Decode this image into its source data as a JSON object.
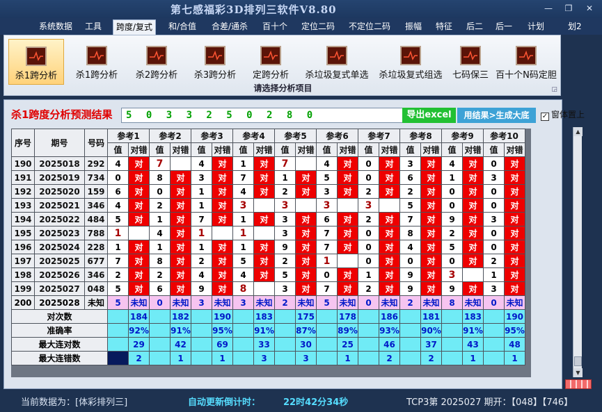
{
  "title": "第七感福彩3D排列三软件V8.80",
  "menu": [
    "系统数据",
    "工具",
    "跨度/复式",
    "和/合值",
    "合差/通杀",
    "百十个",
    "定位二码",
    "不定位二码",
    "振幅",
    "特征",
    "后二",
    "后一",
    "计划",
    "划2"
  ],
  "ribbon": {
    "buttons": [
      "杀1跨分析",
      "杀1跨分析",
      "杀2跨分析",
      "杀3跨分析",
      "定跨分析",
      "杀垃圾复式单选",
      "杀垃圾复式组选",
      "七码保三",
      "百十个N码定胆"
    ],
    "group_label": "请选择分析项目"
  },
  "panel": {
    "heading": "杀1跨度分析预测结果",
    "result_value": "5 0 3 3 2 5 0 2 8 0",
    "excel_label": "导出excel",
    "big_label": "用结果>生成大底",
    "topmost_label": "窗体置上",
    "topmost_check": "✓"
  },
  "table": {
    "headers": {
      "seq": "序号",
      "period": "期号",
      "code": "号码",
      "refs": [
        "参考1",
        "参考2",
        "参考3",
        "参考4",
        "参考5",
        "参考6",
        "参考7",
        "参考8",
        "参考9",
        "参考10"
      ],
      "val": "值",
      "judge": "对错"
    },
    "rows": [
      {
        "seq": "190",
        "period": "2025018",
        "code": "292",
        "cells": [
          [
            "4",
            "对"
          ],
          [
            "7",
            ""
          ],
          [
            "4",
            "对"
          ],
          [
            "1",
            "对"
          ],
          [
            "7",
            ""
          ],
          [
            "4",
            "对"
          ],
          [
            "0",
            "对"
          ],
          [
            "3",
            "对"
          ],
          [
            "4",
            "对"
          ],
          [
            "0",
            "对"
          ]
        ]
      },
      {
        "seq": "191",
        "period": "2025019",
        "code": "734",
        "cells": [
          [
            "0",
            "对"
          ],
          [
            "8",
            "对"
          ],
          [
            "3",
            "对"
          ],
          [
            "7",
            "对"
          ],
          [
            "1",
            "对"
          ],
          [
            "5",
            "对"
          ],
          [
            "0",
            "对"
          ],
          [
            "6",
            "对"
          ],
          [
            "1",
            "对"
          ],
          [
            "3",
            "对"
          ]
        ]
      },
      {
        "seq": "192",
        "period": "2025020",
        "code": "159",
        "cells": [
          [
            "6",
            "对"
          ],
          [
            "0",
            "对"
          ],
          [
            "1",
            "对"
          ],
          [
            "4",
            "对"
          ],
          [
            "2",
            "对"
          ],
          [
            "3",
            "对"
          ],
          [
            "2",
            "对"
          ],
          [
            "2",
            "对"
          ],
          [
            "0",
            "对"
          ],
          [
            "0",
            "对"
          ]
        ]
      },
      {
        "seq": "193",
        "period": "2025021",
        "code": "346",
        "cells": [
          [
            "4",
            "对"
          ],
          [
            "2",
            "对"
          ],
          [
            "1",
            "对"
          ],
          [
            "3",
            ""
          ],
          [
            "3",
            ""
          ],
          [
            "3",
            ""
          ],
          [
            "3",
            ""
          ],
          [
            "5",
            "对"
          ],
          [
            "0",
            "对"
          ],
          [
            "0",
            "对"
          ]
        ]
      },
      {
        "seq": "194",
        "period": "2025022",
        "code": "484",
        "cells": [
          [
            "5",
            "对"
          ],
          [
            "1",
            "对"
          ],
          [
            "7",
            "对"
          ],
          [
            "1",
            "对"
          ],
          [
            "3",
            "对"
          ],
          [
            "6",
            "对"
          ],
          [
            "2",
            "对"
          ],
          [
            "7",
            "对"
          ],
          [
            "9",
            "对"
          ],
          [
            "3",
            "对"
          ]
        ]
      },
      {
        "seq": "195",
        "period": "2025023",
        "code": "788",
        "cells": [
          [
            "1",
            ""
          ],
          [
            "4",
            "对"
          ],
          [
            "1",
            ""
          ],
          [
            "1",
            ""
          ],
          [
            "3",
            "对"
          ],
          [
            "7",
            "对"
          ],
          [
            "0",
            "对"
          ],
          [
            "8",
            "对"
          ],
          [
            "2",
            "对"
          ],
          [
            "0",
            "对"
          ]
        ]
      },
      {
        "seq": "196",
        "period": "2025024",
        "code": "228",
        "cells": [
          [
            "1",
            "对"
          ],
          [
            "1",
            "对"
          ],
          [
            "1",
            "对"
          ],
          [
            "1",
            "对"
          ],
          [
            "9",
            "对"
          ],
          [
            "7",
            "对"
          ],
          [
            "0",
            "对"
          ],
          [
            "4",
            "对"
          ],
          [
            "5",
            "对"
          ],
          [
            "0",
            "对"
          ]
        ]
      },
      {
        "seq": "197",
        "period": "2025025",
        "code": "677",
        "cells": [
          [
            "7",
            "对"
          ],
          [
            "8",
            "对"
          ],
          [
            "2",
            "对"
          ],
          [
            "5",
            "对"
          ],
          [
            "2",
            "对"
          ],
          [
            "1",
            ""
          ],
          [
            "0",
            "对"
          ],
          [
            "0",
            "对"
          ],
          [
            "0",
            "对"
          ],
          [
            "2",
            "对"
          ]
        ]
      },
      {
        "seq": "198",
        "period": "2025026",
        "code": "346",
        "cells": [
          [
            "2",
            "对"
          ],
          [
            "2",
            "对"
          ],
          [
            "4",
            "对"
          ],
          [
            "4",
            "对"
          ],
          [
            "5",
            "对"
          ],
          [
            "0",
            "对"
          ],
          [
            "1",
            "对"
          ],
          [
            "9",
            "对"
          ],
          [
            "3",
            ""
          ],
          [
            "1",
            "对"
          ]
        ]
      },
      {
        "seq": "199",
        "period": "2025027",
        "code": "048",
        "cells": [
          [
            "5",
            "对"
          ],
          [
            "6",
            "对"
          ],
          [
            "9",
            "对"
          ],
          [
            "8",
            ""
          ],
          [
            "3",
            "对"
          ],
          [
            "7",
            "对"
          ],
          [
            "2",
            "对"
          ],
          [
            "9",
            "对"
          ],
          [
            "9",
            "对"
          ],
          [
            "3",
            "对"
          ]
        ]
      }
    ],
    "highlight": [
      [
        false,
        true,
        false,
        false,
        true,
        false,
        false,
        false,
        false,
        false
      ],
      [
        false,
        false,
        false,
        false,
        false,
        false,
        false,
        false,
        false,
        false
      ],
      [
        false,
        false,
        false,
        false,
        false,
        false,
        false,
        false,
        false,
        false
      ],
      [
        false,
        false,
        false,
        true,
        true,
        true,
        true,
        false,
        false,
        false
      ],
      [
        false,
        false,
        false,
        false,
        false,
        false,
        false,
        false,
        false,
        false
      ],
      [
        true,
        false,
        true,
        true,
        false,
        false,
        false,
        false,
        false,
        false
      ],
      [
        false,
        false,
        false,
        false,
        false,
        false,
        false,
        false,
        false,
        false
      ],
      [
        false,
        false,
        false,
        false,
        false,
        true,
        false,
        false,
        false,
        false
      ],
      [
        false,
        false,
        false,
        false,
        false,
        false,
        false,
        false,
        true,
        false
      ],
      [
        false,
        false,
        false,
        true,
        false,
        false,
        false,
        false,
        false,
        false
      ]
    ],
    "forecast": {
      "seq": "200",
      "period": "2025028",
      "code": "未知",
      "values": [
        "5",
        "0",
        "3",
        "3",
        "2",
        "5",
        "0",
        "2",
        "8",
        "0"
      ],
      "label": "未知"
    },
    "stats": [
      {
        "label": "对次数",
        "values": [
          "184",
          "182",
          "190",
          "183",
          "175",
          "178",
          "186",
          "181",
          "183",
          "190"
        ]
      },
      {
        "label": "准确率",
        "values": [
          "92%",
          "91%",
          "95%",
          "91%",
          "87%",
          "89%",
          "93%",
          "90%",
          "91%",
          "95%"
        ]
      },
      {
        "label": "最大连对数",
        "values": [
          "29",
          "42",
          "69",
          "33",
          "30",
          "25",
          "46",
          "37",
          "43",
          "48"
        ]
      },
      {
        "label": "最大连错数",
        "values": [
          "2",
          "1",
          "1",
          "3",
          "3",
          "1",
          "2",
          "2",
          "1",
          "1"
        ]
      }
    ]
  },
  "status": {
    "data_label": "当前数据为：[体彩排列三]",
    "countdown_label": "自动更新倒计时：",
    "countdown_value": "22时42分34秒",
    "latest": "TCP3第 2025027 期开：【048】【746】"
  },
  "colors": {
    "hit": "#ee0000",
    "forecast": "#f6c4f0",
    "stats": "#70ebf6",
    "title": "#c7d7f4"
  }
}
